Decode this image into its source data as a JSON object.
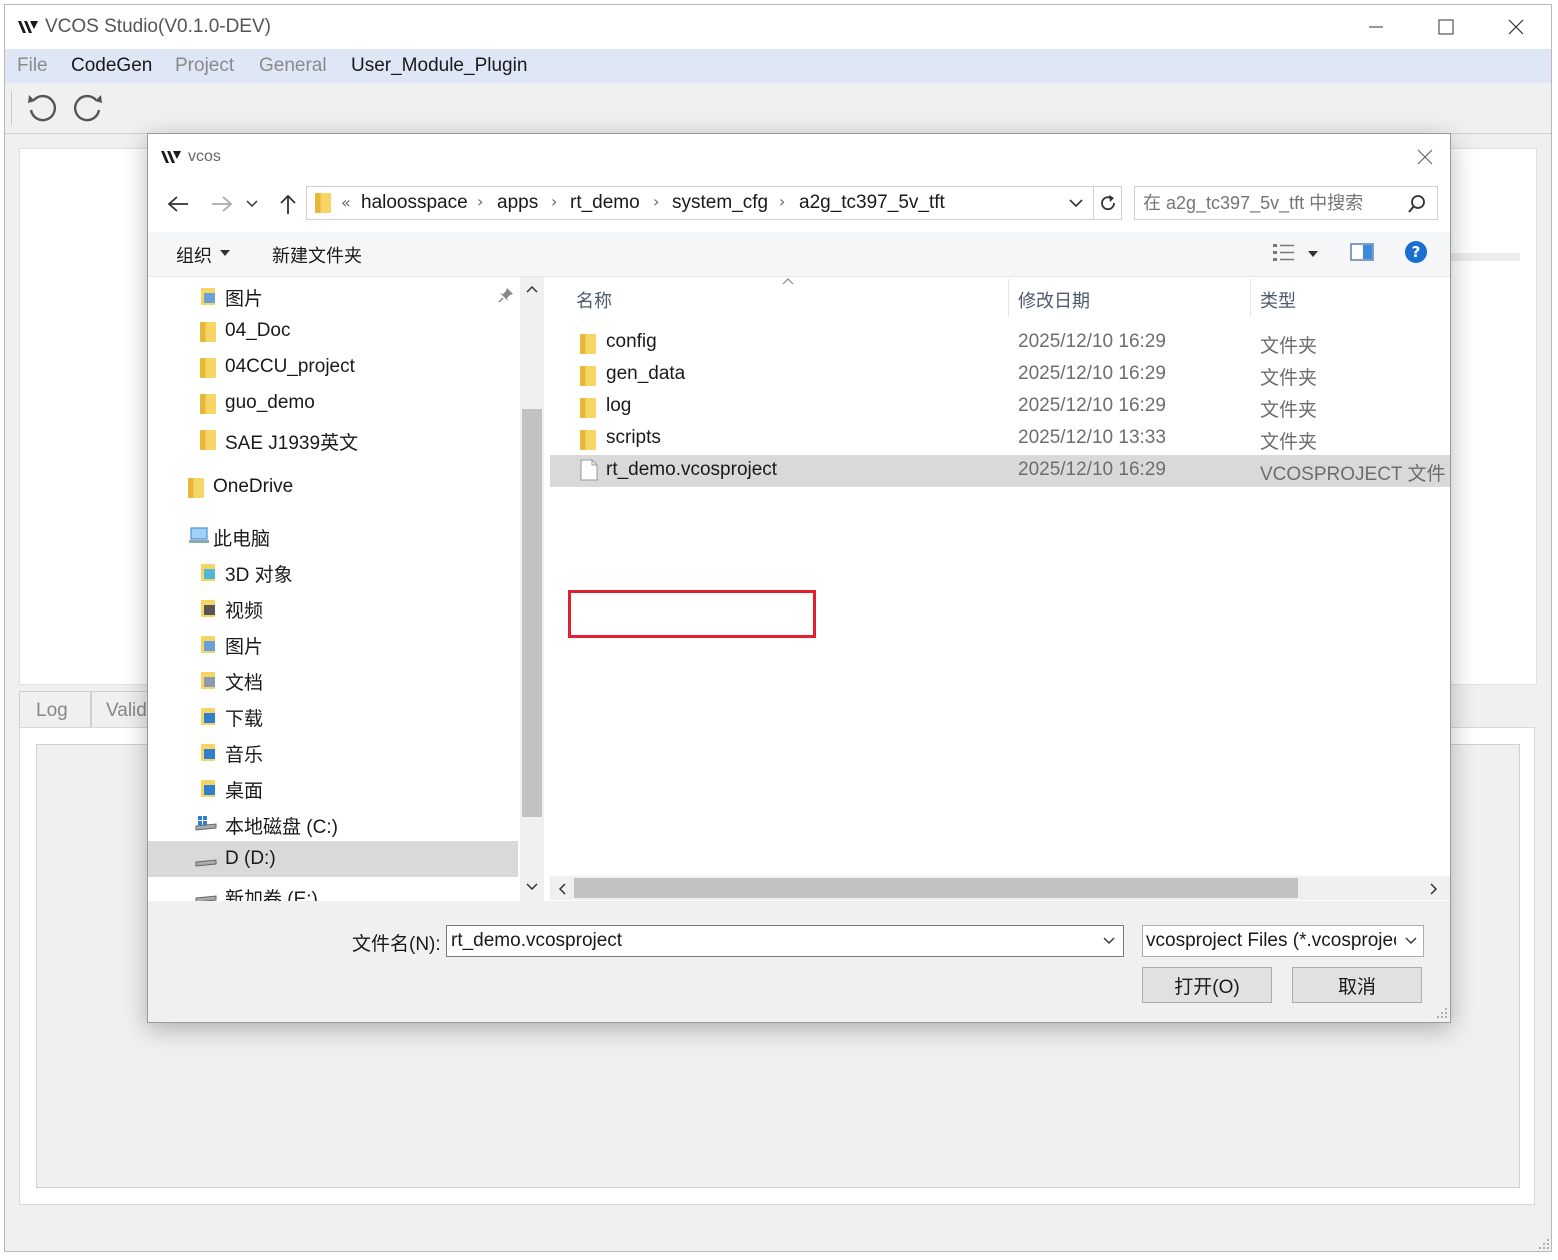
{
  "app": {
    "title": "VCOS Studio(V0.1.0-DEV)",
    "menu": [
      "File",
      "CodeGen",
      "Project",
      "General",
      "User_Module_Plugin"
    ],
    "bottom_tabs": [
      "Log",
      "Valid"
    ]
  },
  "dialog": {
    "title": "vcos",
    "breadcrumb": [
      "«",
      "haloosspace",
      "apps",
      "rt_demo",
      "system_cfg",
      "a2g_tc397_5v_tft"
    ],
    "search_placeholder": "在 a2g_tc397_5v_tft 中搜索",
    "commands": {
      "organize": "组织",
      "new_folder": "新建文件夹"
    },
    "nav_items": [
      {
        "label": "图片",
        "icon": "pictures-folder-icon"
      },
      {
        "label": "04_Doc",
        "icon": "folder-icon"
      },
      {
        "label": "04CCU_project",
        "icon": "folder-icon"
      },
      {
        "label": "guo_demo",
        "icon": "folder-icon"
      },
      {
        "label": "SAE J1939英文",
        "icon": "folder-icon"
      },
      {
        "label": "OneDrive",
        "icon": "onedrive-icon"
      },
      {
        "label": "此电脑",
        "icon": "computer-icon"
      },
      {
        "label": "3D 对象",
        "icon": "3d-objects-icon"
      },
      {
        "label": "视频",
        "icon": "videos-icon"
      },
      {
        "label": "图片",
        "icon": "pictures-folder-icon"
      },
      {
        "label": "文档",
        "icon": "documents-icon"
      },
      {
        "label": "下载",
        "icon": "downloads-icon"
      },
      {
        "label": "音乐",
        "icon": "music-icon"
      },
      {
        "label": "桌面",
        "icon": "desktop-icon"
      },
      {
        "label": "本地磁盘 (C:)",
        "icon": "system-drive-icon"
      },
      {
        "label": "D (D:)",
        "icon": "drive-icon"
      },
      {
        "label": "新加卷 (E:)",
        "icon": "drive-icon"
      }
    ],
    "columns": {
      "name": "名称",
      "date": "修改日期",
      "type": "类型"
    },
    "files": [
      {
        "name": "config",
        "date": "2025/12/10 16:29",
        "type": "文件夹",
        "icon": "folder-icon"
      },
      {
        "name": "gen_data",
        "date": "2025/12/10 16:29",
        "type": "文件夹",
        "icon": "folder-icon"
      },
      {
        "name": "log",
        "date": "2025/12/10 16:29",
        "type": "文件夹",
        "icon": "folder-icon"
      },
      {
        "name": "scripts",
        "date": "2025/12/10 13:33",
        "type": "文件夹",
        "icon": "folder-icon"
      },
      {
        "name": "rt_demo.vcosproject",
        "date": "2025/12/10 16:29",
        "type": "VCOSPROJECT 文件",
        "icon": "file-icon"
      }
    ],
    "filename_label": "文件名(N):",
    "filename_value": "rt_demo.vcosproject",
    "filetype_value": "vcosproject Files (*.vcosproject)",
    "open_button": "打开(O)",
    "cancel_button": "取消"
  },
  "colors": {
    "menubar": "#dfe6f6",
    "selection": "#d9d9d9",
    "nav_selection": "#d9d9d9",
    "highlight_box": "#e0202f",
    "help_blue": "#1a6fd1"
  }
}
